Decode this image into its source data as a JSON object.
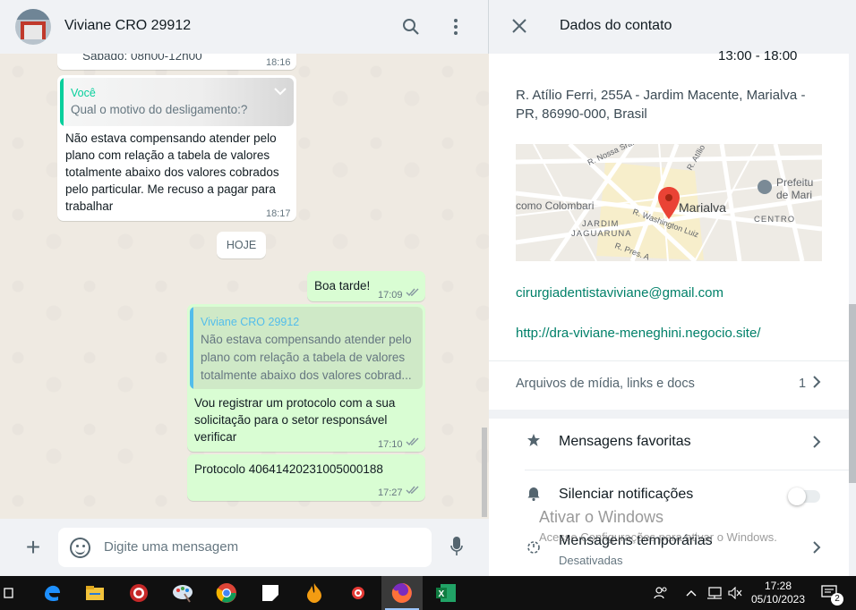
{
  "chat": {
    "contact_name": "Viviane CRO 29912",
    "messages": {
      "partial_in_text": "Sábado: 08h00-12h00",
      "partial_in_time": "18:16",
      "reply_quote_name": "Você",
      "reply_quote_text": "Qual o motivo do desligamento:?",
      "reply_text_lines": [
        "Não estava compensando atender pelo",
        "plano com relação a tabela de valores",
        "totalmente abaixo dos valores cobrados",
        "pelo particular. Me recuso a pagar para",
        "trabalhar"
      ],
      "reply_time": "18:17",
      "date_divider": "HOJE",
      "out1_text": "Boa tarde!",
      "out1_time": "17:09",
      "out2_quote_name": "Viviane CRO 29912",
      "out2_quote_lines": [
        "Não estava compensando atender pelo",
        "plano com relação a tabela de valores",
        "totalmente abaixo dos valores cobrad..."
      ],
      "out2_text_lines": [
        "Vou registrar um protocolo com a sua",
        "solicitação para o setor responsável",
        "verificar"
      ],
      "out2_time": "17:10",
      "out3_text": "Protocolo 40641420231005000188",
      "out3_time": "17:27"
    },
    "composer_placeholder": "Digite uma mensagem"
  },
  "contact": {
    "title": "Dados do contato",
    "hours": "13:00 - 18:00",
    "address_lines": [
      "R. Atílio Ferri, 255A - Jardim Macente, Marialva -",
      "PR, 86990-000, Brasil"
    ],
    "map_labels": {
      "city": "Marialva",
      "prefeitura": "Prefeitu",
      "prefeitura2": "de Mari",
      "colombari": "como Colombari",
      "jardim": "JARDIM",
      "jaguaruna": "JAGUARUNA",
      "centro": "CENTRO",
      "street1": "R. Nossa Sra. do Ro",
      "street2": "R. Washington Luiz",
      "street3": "R. Atílio",
      "street4": "R. Pres. A"
    },
    "email": "cirurgiadentistaviviane@gmail.com",
    "website": "http://dra-viviane-meneghini.negocio.site/",
    "media_label": "Arquivos de mídia, links e docs",
    "media_count": "1",
    "rows": {
      "favorites": "Mensagens favoritas",
      "mute": "Silenciar notificações",
      "temporary": "Mensagens temporárias",
      "temporary_sub": "Desativadas"
    }
  },
  "watermark": {
    "title": "Ativar o Windows",
    "subtitle": "Acesse Configurações para ativar o Windows."
  },
  "taskbar": {
    "time": "17:28",
    "date": "05/10/2023",
    "notifications": "2"
  },
  "colors": {
    "accent": "#008069",
    "outgoing": "#d9fdd3",
    "quote_out_bar": "#53bdeb",
    "quote_in_bar": "#06cf9c"
  }
}
